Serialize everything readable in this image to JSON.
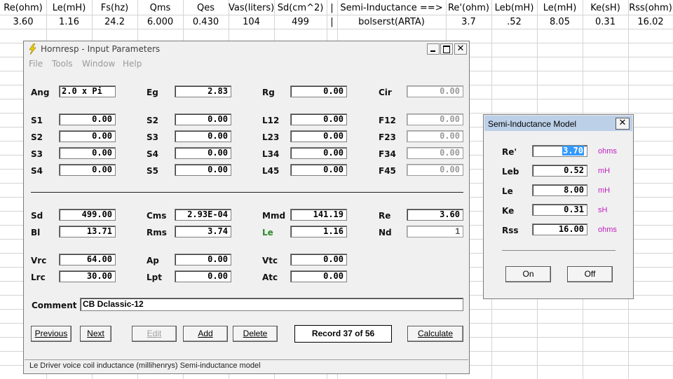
{
  "sheet": {
    "headers": [
      "Re(ohm)",
      "Le(mH)",
      "Fs(hz)",
      "Qms",
      "Qes",
      "Vas(liters)",
      "Sd(cm^2)",
      "|",
      "Semi-Inductance ==>",
      "Re'(ohm)",
      "Leb(mH)",
      "Le(mH)",
      "Ke(sH)",
      "Rss(ohm)"
    ],
    "values": [
      "3.60",
      "1.16",
      "24.2",
      "6.000",
      "0.430",
      "104",
      "499",
      "|",
      "bolserst(ARTA)",
      "3.7",
      ".52",
      "8.05",
      "0.31",
      "16.02"
    ]
  },
  "window": {
    "title": "Hornresp - Input Parameters",
    "menu": [
      "File",
      "Tools",
      "Window",
      "Help"
    ],
    "rows1": [
      {
        "labels": [
          "Ang",
          "Eg",
          "Rg",
          "Cir"
        ],
        "values": [
          "2.0 x Pi",
          "2.83",
          "0.00",
          "0.00"
        ]
      },
      {
        "labels": [
          "S1",
          "S2",
          "L12",
          "F12"
        ],
        "values": [
          "0.00",
          "0.00",
          "0.00",
          "0.00"
        ]
      },
      {
        "labels": [
          "S2",
          "S3",
          "L23",
          "F23"
        ],
        "values": [
          "0.00",
          "0.00",
          "0.00",
          "0.00"
        ]
      },
      {
        "labels": [
          "S3",
          "S4",
          "L34",
          "F34"
        ],
        "values": [
          "0.00",
          "0.00",
          "0.00",
          "0.00"
        ]
      },
      {
        "labels": [
          "S4",
          "S5",
          "L45",
          "F45"
        ],
        "values": [
          "0.00",
          "0.00",
          "0.00",
          "0.00"
        ]
      }
    ],
    "rows2": [
      {
        "labels": [
          "Sd",
          "Cms",
          "Mmd",
          "Re"
        ],
        "values": [
          "499.00",
          "2.93E-04",
          "141.19",
          "3.60"
        ]
      },
      {
        "labels": [
          "Bl",
          "Rms",
          "Le",
          "Nd"
        ],
        "values": [
          "13.71",
          "3.74",
          "1.16",
          "1"
        ]
      },
      {
        "labels": [
          "Vrc",
          "Ap",
          "Vtc"
        ],
        "values": [
          "64.00",
          "0.00",
          "0.00"
        ]
      },
      {
        "labels": [
          "Lrc",
          "Lpt",
          "Atc"
        ],
        "values": [
          "30.00",
          "0.00",
          "0.00"
        ]
      }
    ],
    "comment_label": "Comment",
    "comment_value": "CB Dclassic-12",
    "buttons": {
      "previous": "Previous",
      "next": "Next",
      "edit": "Edit",
      "add": "Add",
      "delete": "Delete",
      "calculate": "Calculate"
    },
    "record": "Record 37 of 56",
    "status": "Le   Driver voice coil inductance  (millihenrys)   Semi-inductance model"
  },
  "dialog": {
    "title": "Semi-Inductance Model",
    "rows": [
      {
        "label": "Re'",
        "value": "3.70",
        "unit": "ohms"
      },
      {
        "label": "Leb",
        "value": "0.52",
        "unit": "mH"
      },
      {
        "label": "Le",
        "value": "8.00",
        "unit": "mH"
      },
      {
        "label": "Ke",
        "value": "0.31",
        "unit": "sH"
      },
      {
        "label": "Rss",
        "value": "16.00",
        "unit": "ohms"
      }
    ],
    "on_label": "On",
    "off_label": "Off"
  },
  "colors": {
    "unit_color": "#c020c0",
    "le_label_color": "#2c8a2c",
    "dialog_titlebar": "#bcd0e8",
    "selection": "#3399ff"
  },
  "icons": {
    "app_icon": "lightning-bolt-icon",
    "minimize": "minimize-icon",
    "maximize": "maximize-icon",
    "close": "close-icon"
  }
}
